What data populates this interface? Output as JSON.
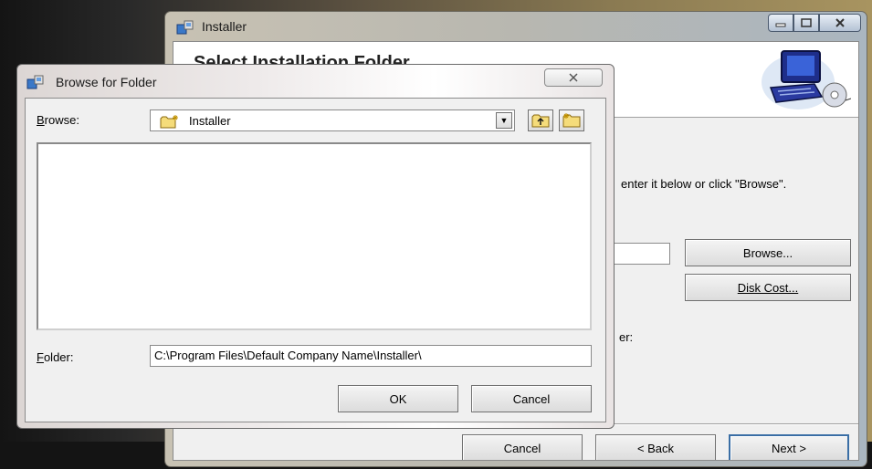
{
  "installer": {
    "title": "Installer",
    "heading": "Select Installation Folder",
    "instruction_fragment": "enter it below or click \"Browse\".",
    "browse_button": "Browse...",
    "disk_cost_button": "Disk Cost...",
    "install_for_fragment": "er:",
    "cancel_button": "Cancel",
    "back_button": "< Back",
    "next_button": "Next >"
  },
  "browse_dialog": {
    "title": "Browse for Folder",
    "browse_label": "Browse:",
    "combo_value": "Installer",
    "folder_label": "Folder:",
    "folder_path": "C:\\Program Files\\Default Company Name\\Installer\\",
    "ok_button": "OK",
    "cancel_button": "Cancel"
  },
  "icons": {
    "installer_title": "installer-package-icon",
    "browse_title": "installer-package-icon",
    "combo": "folder-open-icon",
    "up_folder": "up-one-level-icon",
    "new_folder": "new-folder-icon",
    "banner": "computer-cd-icon"
  }
}
